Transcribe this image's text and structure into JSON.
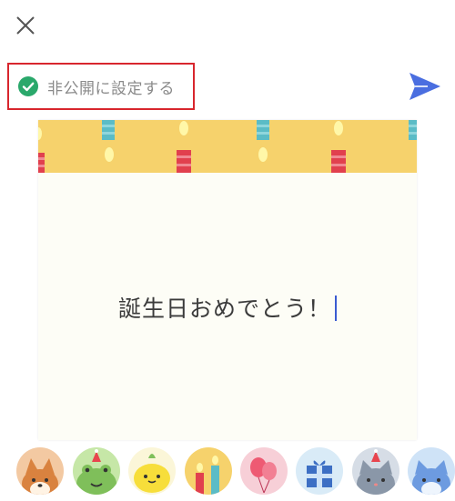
{
  "header": {
    "close_icon": "close-icon",
    "privacy": {
      "label": "非公開に設定する",
      "checked": true,
      "check_color": "#2aa86b"
    },
    "send_icon": "send-icon",
    "send_color": "#4a6ee0"
  },
  "card": {
    "message": "誕生日おめでとう！",
    "theme": "birthday-candles",
    "banner_color": "#f6d26c"
  },
  "stickers": [
    {
      "name": "shiba-dog-sticker",
      "icon": "shiba-dog"
    },
    {
      "name": "frog-sticker",
      "icon": "frog-with-party-hat"
    },
    {
      "name": "lemon-sticker",
      "icon": "lemon-character"
    },
    {
      "name": "candles-sticker",
      "icon": "birthday-candles"
    },
    {
      "name": "balloons-sticker",
      "icon": "balloons"
    },
    {
      "name": "gift-box-sticker",
      "icon": "gift-box"
    },
    {
      "name": "gray-cat-sticker",
      "icon": "gray-cat-with-party-hat"
    },
    {
      "name": "blue-cat-sticker",
      "icon": "blue-cat"
    }
  ]
}
